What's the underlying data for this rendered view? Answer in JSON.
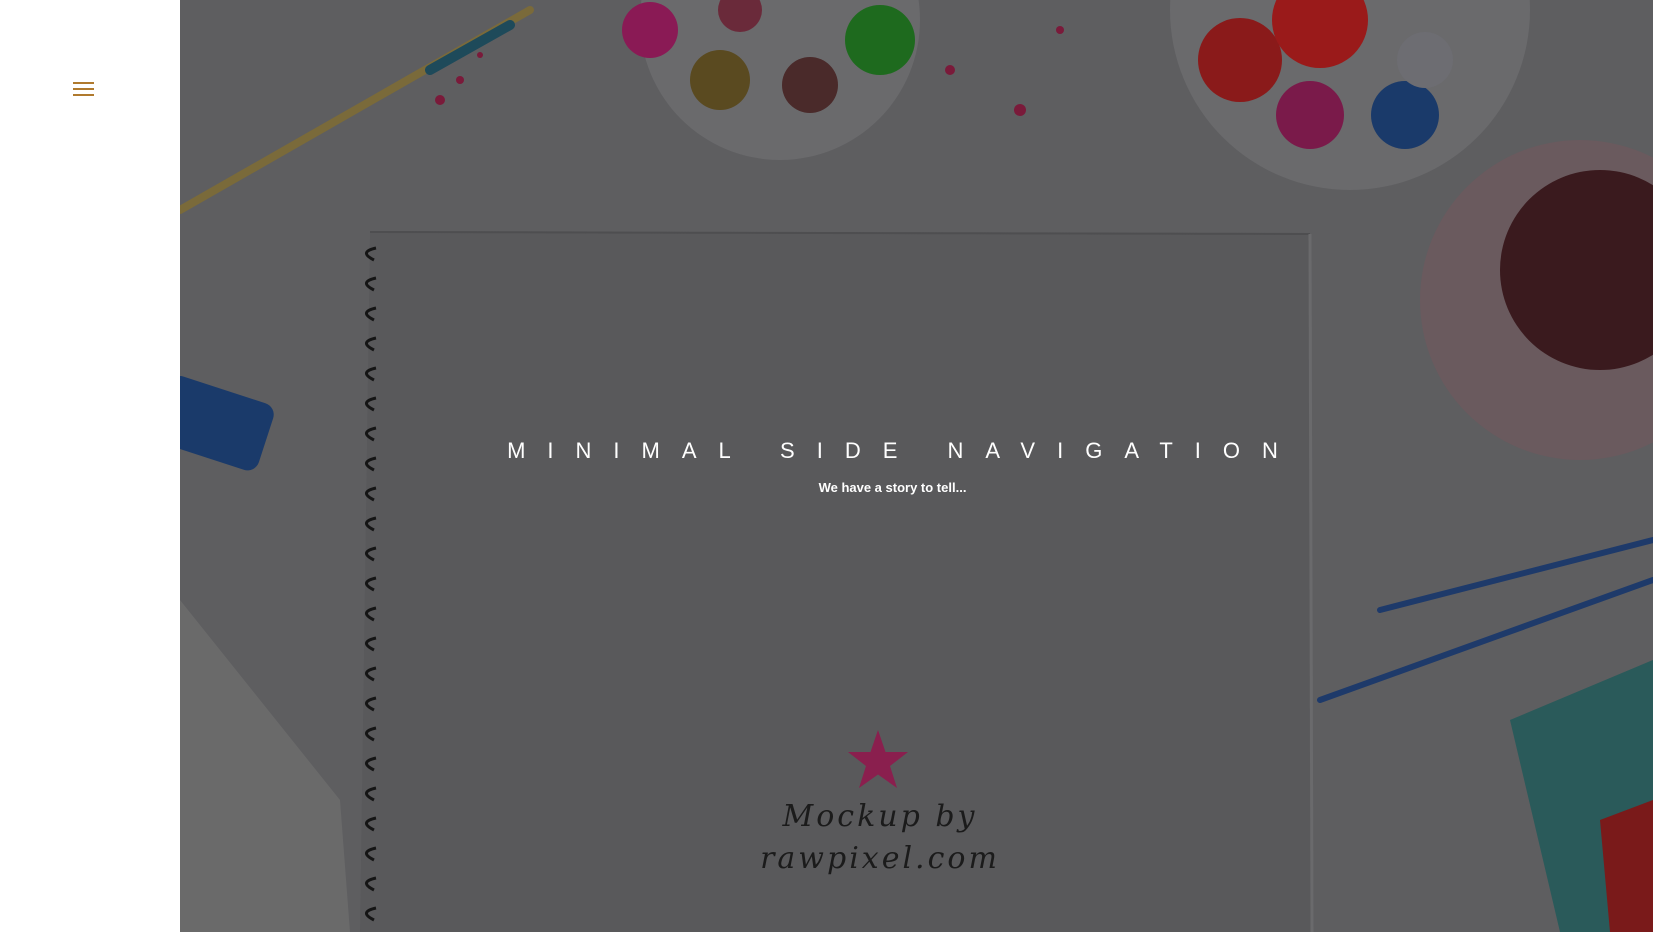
{
  "sidebar": {
    "menu_icon": "hamburger-menu-icon",
    "accent_color": "#b07a2e"
  },
  "hero": {
    "title": "MINIMAL SIDE NAVIGATION",
    "subtitle": "We have a story to tell...",
    "mockup_line1": "Mockup by",
    "mockup_line2": "rawpixel.com",
    "mockup_icon": "star-icon",
    "mockup_star_color": "#8a1f4e"
  }
}
